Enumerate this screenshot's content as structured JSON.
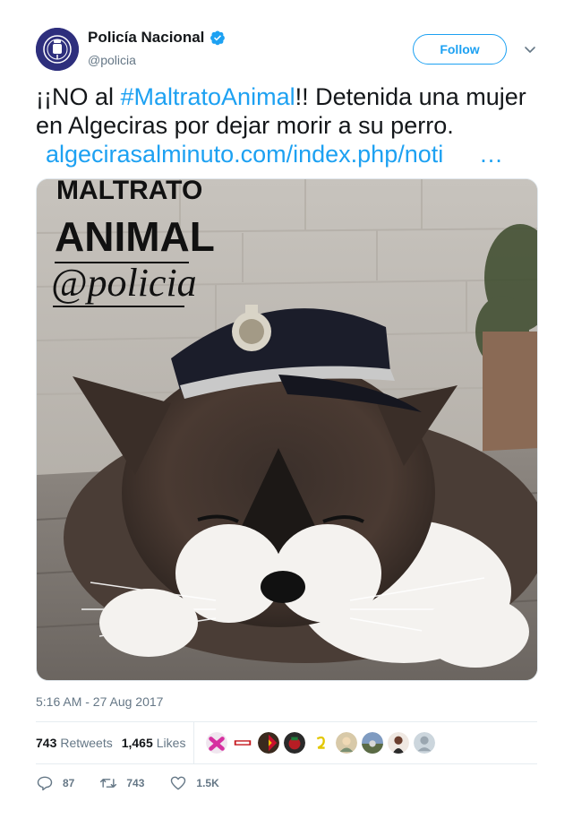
{
  "author": {
    "display_name": "Policía Nacional",
    "handle": "@policia",
    "verified": true,
    "avatar_icon": "police-badge-icon"
  },
  "follow_label": "Follow",
  "tweet": {
    "prefix": "¡¡NO al ",
    "hashtag": "#MaltratoAnimal",
    "suffix": "!! Detenida una mujer en Algeciras por dejar morir a su perro.",
    "link": "algecirasalminuto.com/index.php/noti",
    "ellipsis": "…"
  },
  "media": {
    "overlay_line1": "MALTRATO",
    "overlay_line2": "ANIMAL",
    "overlay_line3": "@policia"
  },
  "timestamp": "5:16 AM - 27 Aug 2017",
  "stats": {
    "retweets_count": "743",
    "retweets_label": "Retweets",
    "likes_count": "1,465",
    "likes_label": "Likes"
  },
  "actions": {
    "reply_count": "87",
    "retweet_count": "743",
    "like_count": "1.5K"
  },
  "colors": {
    "accent": "#1da1f2",
    "muted": "#657786",
    "text": "#14171a"
  }
}
